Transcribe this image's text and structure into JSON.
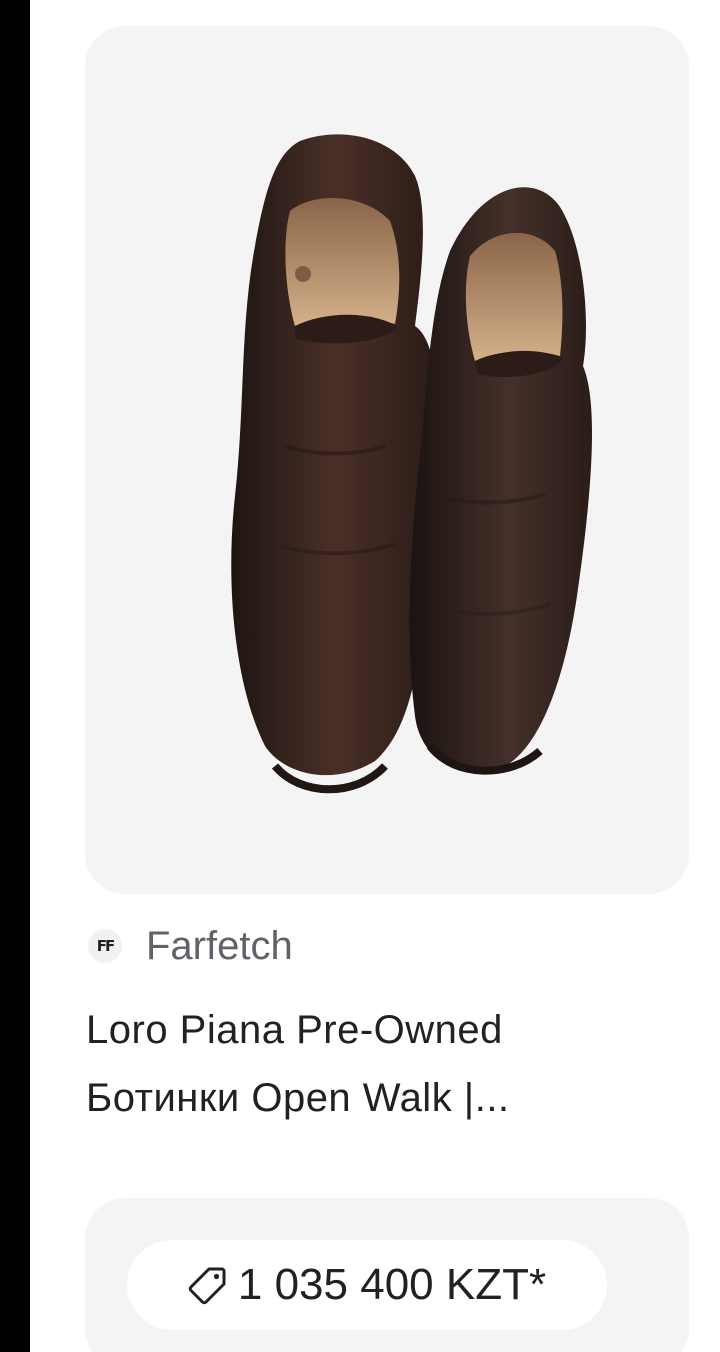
{
  "product": {
    "image_alt": "Loro Piana Pre-Owned boots",
    "source_logo": "FF",
    "source": "Farfetch",
    "title_line1": "Loro Piana Pre-Owned",
    "title_line2": "Ботинки Open Walk |...",
    "price": "1 035 400 KZT*",
    "price_icon": "tag-icon"
  },
  "colors": {
    "panel_bg": "#f4f4f4",
    "text_primary": "#202124",
    "text_secondary": "#5f6368",
    "leather": "#3b2620",
    "lining": "#c9a27a"
  }
}
